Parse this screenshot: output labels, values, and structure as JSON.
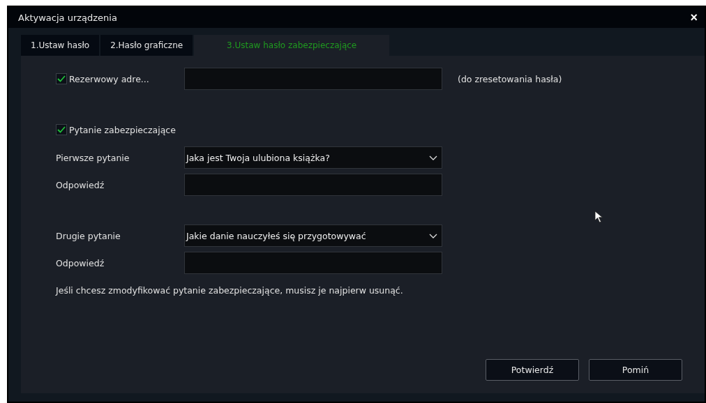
{
  "window": {
    "title": "Aktywacja urządzenia",
    "close": "×"
  },
  "tabs": [
    {
      "label": "1.Ustaw hasło",
      "selected": false
    },
    {
      "label": "2.Hasło graficzne",
      "selected": false
    },
    {
      "label": "3.Ustaw hasło zabezpieczające",
      "selected": true
    }
  ],
  "backup_email": {
    "label": "Rezerwowy adre...",
    "checked": true,
    "hint": "(do zresetowania hasła)"
  },
  "security_question": {
    "label": "Pytanie zabezpieczające",
    "checked": true
  },
  "questions": [
    {
      "label": "Pierwsze pytanie",
      "value": "Jaka jest Twoja ulubiona książka?",
      "answer_label": "Odpowiedź"
    },
    {
      "label": "Drugie pytanie",
      "value": "Jakie danie nauczyłeś się przygotowywać",
      "answer_label": "Odpowiedź"
    }
  ],
  "note": "Jeśli chcesz zmodyfikować pytanie zabezpieczające, musisz je najpierw usunąć.",
  "buttons": [
    "Potwierdź",
    "Pomiń"
  ]
}
